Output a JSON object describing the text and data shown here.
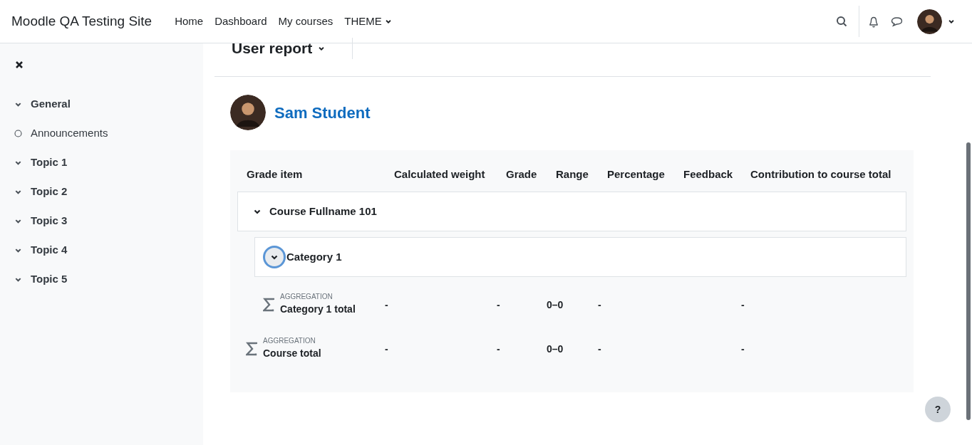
{
  "site_name": "Moodle QA Testing Site",
  "nav": [
    {
      "label": "Home",
      "dropdown": false
    },
    {
      "label": "Dashboard",
      "dropdown": false
    },
    {
      "label": "My courses",
      "dropdown": false
    },
    {
      "label": "THEME",
      "dropdown": true
    }
  ],
  "sidebar": {
    "items": [
      {
        "kind": "section",
        "label": "General"
      },
      {
        "kind": "activity",
        "label": "Announcements"
      },
      {
        "kind": "section",
        "label": "Topic 1"
      },
      {
        "kind": "section",
        "label": "Topic 2"
      },
      {
        "kind": "section",
        "label": "Topic 3"
      },
      {
        "kind": "section",
        "label": "Topic 4"
      },
      {
        "kind": "section",
        "label": "Topic 5"
      }
    ]
  },
  "report_selector": "User report",
  "user_name": "Sam Student",
  "table": {
    "columns": [
      "Grade item",
      "Calculated weight",
      "Grade",
      "Range",
      "Percentage",
      "Feedback",
      "Contribution to course total"
    ],
    "rows": [
      {
        "kind": "category",
        "name": "Course Fullname 101",
        "expanded": true,
        "focused": false,
        "children": [
          {
            "kind": "category",
            "name": "Category 1",
            "expanded": true,
            "focused": true,
            "children": [
              {
                "kind": "total",
                "label": "AGGREGATION",
                "name": "Category 1 total",
                "calculated_weight": "-",
                "grade": "-",
                "range": "0–0",
                "percentage": "-",
                "contribution": "-"
              }
            ]
          },
          {
            "kind": "total",
            "label": "AGGREGATION",
            "name": "Course total",
            "calculated_weight": "-",
            "grade": "-",
            "range": "0–0",
            "percentage": "-",
            "contribution": "-"
          }
        ]
      }
    ]
  },
  "help_button": "?"
}
